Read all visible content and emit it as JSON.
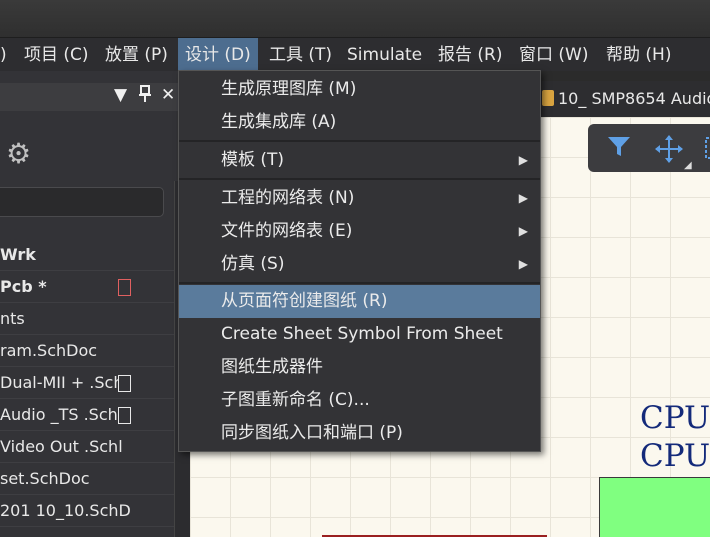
{
  "menubar": [
    {
      "label": ")"
    },
    {
      "label": "项目 (C)"
    },
    {
      "label": "放置 (P)"
    },
    {
      "label": "设计 (D)"
    },
    {
      "label": "工具 (T)"
    },
    {
      "label": "Simulate"
    },
    {
      "label": "报告 (R)"
    },
    {
      "label": "窗口 (W)"
    },
    {
      "label": "帮助 (H)"
    }
  ],
  "panel": {
    "icons": [
      "chevron-down-icon",
      "pin-icon",
      "close-icon",
      "gear-icon"
    ],
    "tree": [
      {
        "label": "Wrk",
        "bold": true
      },
      {
        "label": "Pcb *",
        "bold": true,
        "icon": "pcb-doc-icon"
      },
      {
        "label": "nts"
      },
      {
        "label": "ram.SchDoc"
      },
      {
        "label": "Dual-MII + .Sch",
        "icon": "doc-icon"
      },
      {
        "label": "Audio _TS .SchD",
        "icon": "doc-icon"
      },
      {
        "label": "Video Out .Schl"
      },
      {
        "label": "set.SchDoc"
      },
      {
        "label": "201 10_10.SchD"
      }
    ]
  },
  "doc_tab": {
    "label": "10_ SMP8654 Audio"
  },
  "canvas": {
    "labels": [
      "CPU",
      "CPU"
    ]
  },
  "design_menu": {
    "items": [
      {
        "label": "生成原理图库 (M)"
      },
      {
        "label": "生成集成库 (A)"
      },
      {
        "label": "模板 (T)",
        "submenu": true
      },
      {
        "label": "工程的网络表 (N)",
        "submenu": true
      },
      {
        "label": "文件的网络表 (E)",
        "submenu": true
      },
      {
        "label": "仿真 (S)",
        "submenu": true
      },
      {
        "label": "从页面符创建图纸 (R)",
        "highlighted": true
      },
      {
        "label": "Create Sheet Symbol From Sheet"
      },
      {
        "label": "图纸生成器件"
      },
      {
        "label": "子图重新命名 (C)..."
      },
      {
        "label": "同步图纸入口和端口 (P)"
      }
    ]
  },
  "colors": {
    "menu_highlight": "#5a7b9c",
    "cpu_text": "#142a7a",
    "block_fill": "#80ff80"
  }
}
